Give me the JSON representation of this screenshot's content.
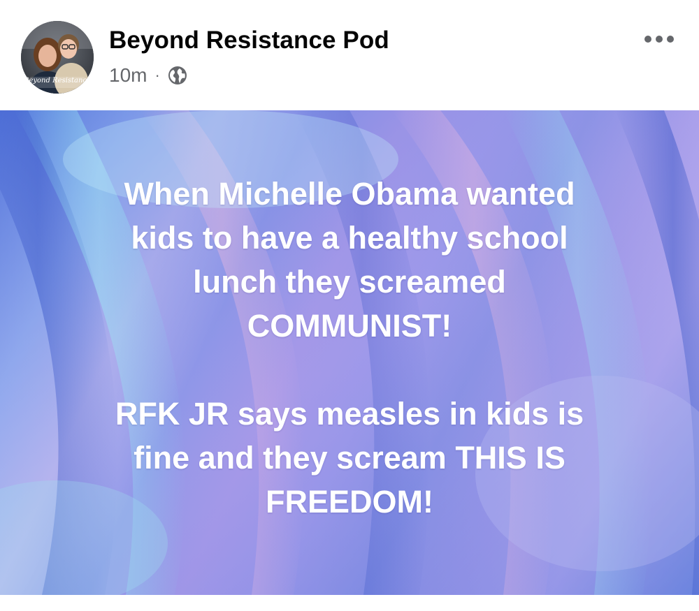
{
  "post": {
    "author_name": "Beyond Resistance Pod",
    "timestamp": "10m",
    "separator": "·",
    "audience_icon": "globe-icon",
    "avatar_caption": "Beyond Resistance",
    "more_icon": "more-options-icon",
    "body": {
      "paragraph_1": "When Michelle Obama wanted\nkids to have a healthy school\nlunch they screamed\nCOMMUNIST!",
      "paragraph_2": "RFK JR says measles in kids is\nfine and they scream THIS IS\nFREEDOM!"
    }
  },
  "colors": {
    "name_text": "#050505",
    "meta_text": "#65676b",
    "post_text": "#ffffff",
    "background_accent": "#8f8fe8"
  }
}
